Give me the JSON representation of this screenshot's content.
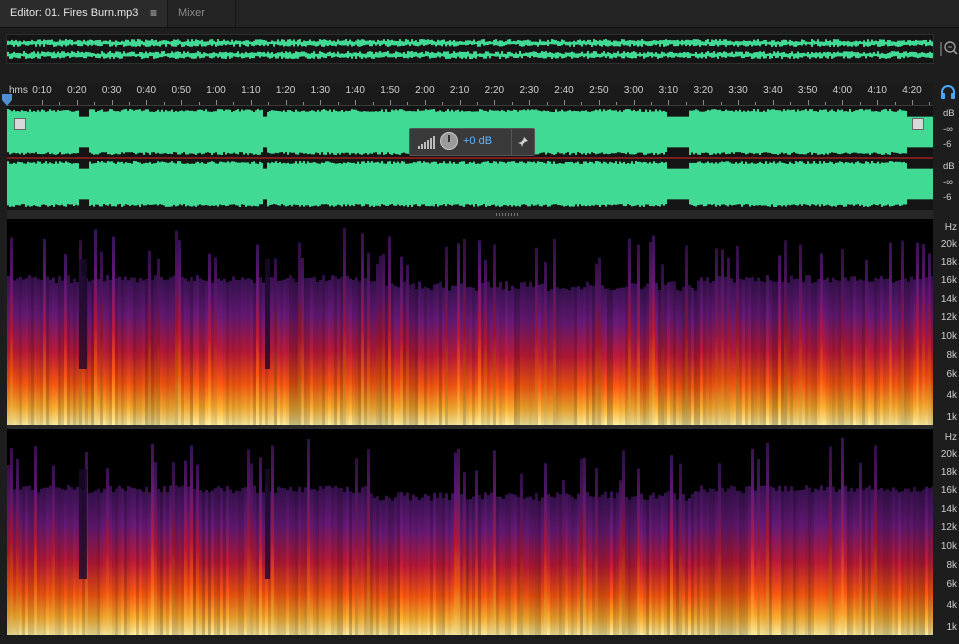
{
  "tabs": {
    "editor_label": "Editor: 01. Fires Burn.mp3",
    "editor_menu_glyph": "≡",
    "mixer_label": "Mixer"
  },
  "ruler": {
    "unit_label": "hms",
    "ticks": [
      "0:10",
      "0:20",
      "0:30",
      "0:40",
      "0:50",
      "1:00",
      "1:10",
      "1:20",
      "1:30",
      "1:40",
      "1:50",
      "2:00",
      "2:10",
      "2:20",
      "2:30",
      "2:40",
      "2:50",
      "3:00",
      "3:10",
      "3:20",
      "3:30",
      "3:40",
      "3:50",
      "4:00",
      "4:10",
      "4:20"
    ]
  },
  "db_scale": {
    "channel_1": [
      "dB",
      "-∞",
      "-6"
    ],
    "channel_2": [
      "dB",
      "-∞",
      "-6"
    ]
  },
  "hud": {
    "gain_label": "+0 dB",
    "pin_glyph": "✦"
  },
  "spectral_scale": {
    "labels": [
      "Hz",
      "20k",
      "18k",
      "16k",
      "14k",
      "12k",
      "10k",
      "8k",
      "6k",
      "4k",
      "1k"
    ]
  },
  "colors": {
    "waveform": "#41da95",
    "waveform_dark": "#0f1a14",
    "accent_blue": "#5fb6ff"
  },
  "icons": {
    "zoom": "magnifier-zoom-icon",
    "headphones": "headphones-icon",
    "level": "level-bars-icon",
    "pin": "pin-icon"
  }
}
